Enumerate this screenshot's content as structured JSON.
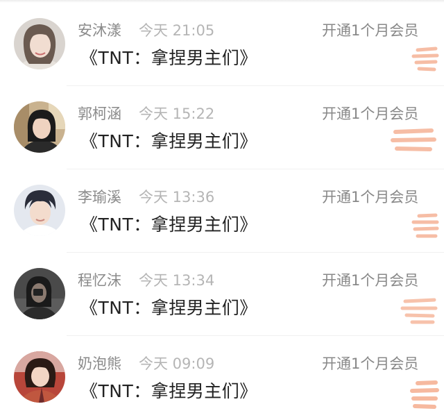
{
  "messages": [
    {
      "name": "安沐漾",
      "time": "今天 21:05",
      "action": "开通1个月会员",
      "title": "《TNT：拿捏男主们》",
      "avatar": {
        "bg": "#d9d4cf",
        "skin": "#f1ddd1",
        "hair": "#6a5a50",
        "shirt": "#e7e2dc"
      }
    },
    {
      "name": "郭柯涵",
      "time": "今天 15:22",
      "action": "开通1个月会员",
      "title": "《TNT：拿捏男主们》",
      "avatar": {
        "bg": "#c9b28f",
        "skin": "#efd3c0",
        "hair": "#1b1b1b",
        "shirt": "#2a2a2a"
      }
    },
    {
      "name": "李瑜溪",
      "time": "今天 13:36",
      "action": "开通1个月会员",
      "title": "《TNT：拿捏男主们》",
      "avatar": {
        "bg": "#e4e8ef",
        "skin": "#f3dccd",
        "hair": "#2a2d3a",
        "shirt": "#ffffff"
      }
    },
    {
      "name": "程忆沫",
      "time": "今天 13:34",
      "action": "开通1个月会员",
      "title": "《TNT：拿捏男主们》",
      "avatar": {
        "bg": "#4a4a4a",
        "skin": "#8b7a70",
        "hair": "#1a1a1a",
        "shirt": "#2b2b2b"
      }
    },
    {
      "name": "奶泡熊",
      "time": "今天 09:09",
      "action": "开通1个月会员",
      "title": "《TNT：拿捏男主们》",
      "avatar": {
        "bg": "#b8463a",
        "skin": "#f2d5c4",
        "hair": "#2b1a15",
        "shirt": "#c0573f"
      }
    }
  ],
  "colors": {
    "name": "#8a8a8a",
    "time": "#b5b5b5",
    "action": "#888888",
    "title": "#222222",
    "sticker": "#f3a27f"
  }
}
